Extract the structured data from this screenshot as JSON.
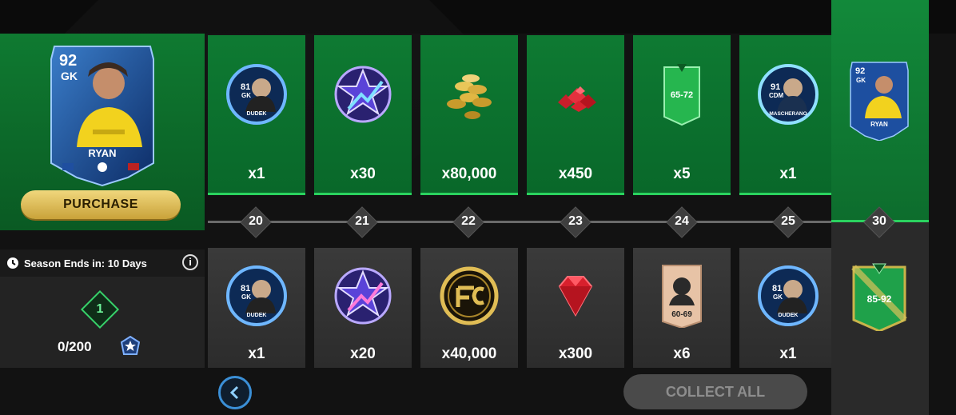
{
  "hero": {
    "player": {
      "rating": "92",
      "position": "GK",
      "name": "RYAN"
    },
    "purchase_label": "PURCHASE"
  },
  "season": {
    "label": "Season Ends in: 10 Days",
    "info_icon": "info-icon"
  },
  "level": {
    "number": "1",
    "progress": "0/200"
  },
  "top_rewards": [
    {
      "kind": "player-token",
      "rating": "81",
      "position": "GK",
      "name": "DUDEK",
      "qty": "x1"
    },
    {
      "kind": "star-points",
      "qty": "x30"
    },
    {
      "kind": "coins",
      "qty": "x80,000"
    },
    {
      "kind": "gems",
      "qty": "x450"
    },
    {
      "kind": "pack",
      "range": "65-72",
      "qty": "x5"
    },
    {
      "kind": "player-token",
      "rating": "91",
      "position": "CDM",
      "name": "MASCHERANO",
      "qty": "x1"
    }
  ],
  "levels": [
    "20",
    "21",
    "22",
    "23",
    "24",
    "25"
  ],
  "bottom_rewards": [
    {
      "kind": "player-token",
      "rating": "81",
      "position": "GK",
      "name": "DUDEK",
      "qty": "x1"
    },
    {
      "kind": "star-points",
      "qty": "x20"
    },
    {
      "kind": "fc-coin",
      "qty": "x40,000"
    },
    {
      "kind": "gem",
      "qty": "x300"
    },
    {
      "kind": "player-card",
      "range": "60-69",
      "qty": "x6"
    },
    {
      "kind": "player-token",
      "rating": "81",
      "position": "GK",
      "name": "DUDEK",
      "qty": "x1"
    }
  ],
  "final": {
    "level": "30",
    "card": {
      "rating": "92",
      "position": "GK",
      "name": "RYAN"
    },
    "pack_range": "85-92"
  },
  "controls": {
    "collect_all": "COLLECT ALL",
    "back_icon": "chevron-left-icon"
  },
  "colors": {
    "green": "#0e7a32",
    "accent": "#2ad35f",
    "gold": "#e0bd55",
    "blue": "#3b8fd6"
  }
}
